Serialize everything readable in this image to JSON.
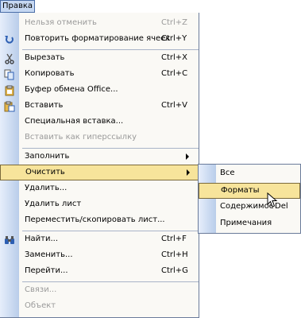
{
  "menubar": {
    "tab_label": "Правка"
  },
  "menu": {
    "items": [
      {
        "label": "Нельзя отменить",
        "shortcut": "Ctrl+Z",
        "icon": "undo-icon"
      },
      {
        "label": "Повторить форматирование ячеек",
        "shortcut": "Ctrl+Y",
        "icon": "redo-icon"
      },
      {
        "label": "Вырезать",
        "shortcut": "Ctrl+X",
        "icon": "scissors-icon"
      },
      {
        "label": "Копировать",
        "shortcut": "Ctrl+C",
        "icon": "copy-icon"
      },
      {
        "label": "Буфер обмена Office...",
        "shortcut": "",
        "icon": "clipboard-icon"
      },
      {
        "label": "Вставить",
        "shortcut": "Ctrl+V",
        "icon": "paste-icon"
      },
      {
        "label": "Специальная вставка...",
        "shortcut": "",
        "icon": ""
      },
      {
        "label": "Вставить как гиперссылку",
        "shortcut": "",
        "icon": ""
      },
      {
        "label": "Заполнить",
        "shortcut": "",
        "icon": ""
      },
      {
        "label": "Очистить",
        "shortcut": "",
        "icon": ""
      },
      {
        "label": "Удалить...",
        "shortcut": "",
        "icon": ""
      },
      {
        "label": "Удалить лист",
        "shortcut": "",
        "icon": ""
      },
      {
        "label": "Переместить/скопировать лист...",
        "shortcut": "",
        "icon": ""
      },
      {
        "label": "Найти...",
        "shortcut": "Ctrl+F",
        "icon": "binoculars-icon"
      },
      {
        "label": "Заменить...",
        "shortcut": "Ctrl+H",
        "icon": ""
      },
      {
        "label": "Перейти...",
        "shortcut": "Ctrl+G",
        "icon": ""
      },
      {
        "label": "Связи...",
        "shortcut": "",
        "icon": ""
      },
      {
        "label": "Объект",
        "shortcut": "",
        "icon": ""
      }
    ]
  },
  "submenu": {
    "items": [
      {
        "label": "Все",
        "shortcut": ""
      },
      {
        "label": "Форматы",
        "shortcut": ""
      },
      {
        "label": "Содержимое",
        "shortcut": "Del"
      },
      {
        "label": "Примечания",
        "shortcut": ""
      }
    ]
  },
  "colors": {
    "highlight": "#f7e49b",
    "gutter": "#b9cdea",
    "disabled_text": "#9a9a9a"
  }
}
